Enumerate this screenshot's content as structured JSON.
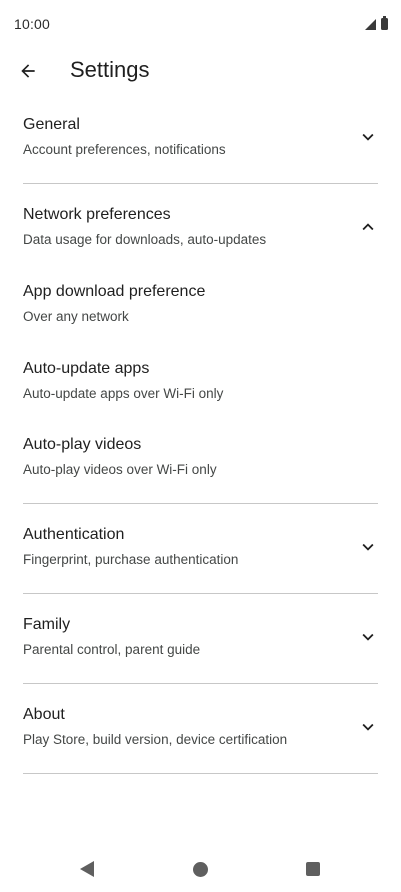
{
  "status_bar": {
    "time": "10:00",
    "icons": [
      "signal-icon",
      "battery-icon"
    ]
  },
  "header": {
    "back_icon": "arrow-back-icon",
    "title": "Settings"
  },
  "sections": [
    {
      "title": "General",
      "subtitle": "Account preferences, notifications",
      "expanded": false
    },
    {
      "title": "Network preferences",
      "subtitle": "Data usage for downloads, auto-updates",
      "expanded": true,
      "items": [
        {
          "title": "App download preference",
          "subtitle": "Over any network"
        },
        {
          "title": "Auto-update apps",
          "subtitle": "Auto-update apps over Wi-Fi only"
        },
        {
          "title": "Auto-play videos",
          "subtitle": "Auto-play videos over Wi-Fi only"
        }
      ]
    },
    {
      "title": "Authentication",
      "subtitle": "Fingerprint, purchase authentication",
      "expanded": false
    },
    {
      "title": "Family",
      "subtitle": "Parental control, parent guide",
      "expanded": false
    },
    {
      "title": "About",
      "subtitle": "Play Store, build version, device certification",
      "expanded": false
    }
  ],
  "nav_bar": {
    "icons": [
      "nav-back-icon",
      "home-icon",
      "recents-icon"
    ]
  },
  "colors": {
    "text_primary": "#1f1f1f",
    "text_secondary": "#444746",
    "divider": "#c7c7c7",
    "nav_icons": "#5f5f5f"
  }
}
